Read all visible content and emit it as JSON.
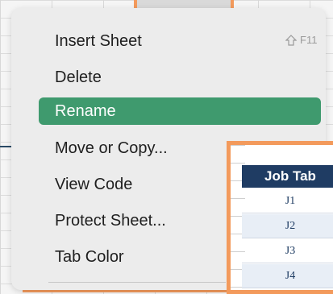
{
  "context_menu": {
    "items": [
      {
        "label": "Insert Sheet",
        "shortcut": "F11"
      },
      {
        "label": "Delete"
      },
      {
        "label": "Rename",
        "selected": true
      },
      {
        "label": "Move or Copy..."
      },
      {
        "label": "View Code"
      },
      {
        "label": "Protect Sheet..."
      },
      {
        "label": "Tab Color"
      }
    ],
    "shortcut_icon": "shift-key-icon"
  },
  "job_table": {
    "header": "Job Tab",
    "rows": [
      "J1",
      "J2",
      "J3",
      "J4"
    ]
  },
  "colors": {
    "highlight_frame": "#f39a5c",
    "selected_item": "#3f9a6e",
    "table_header": "#1f3c63"
  }
}
